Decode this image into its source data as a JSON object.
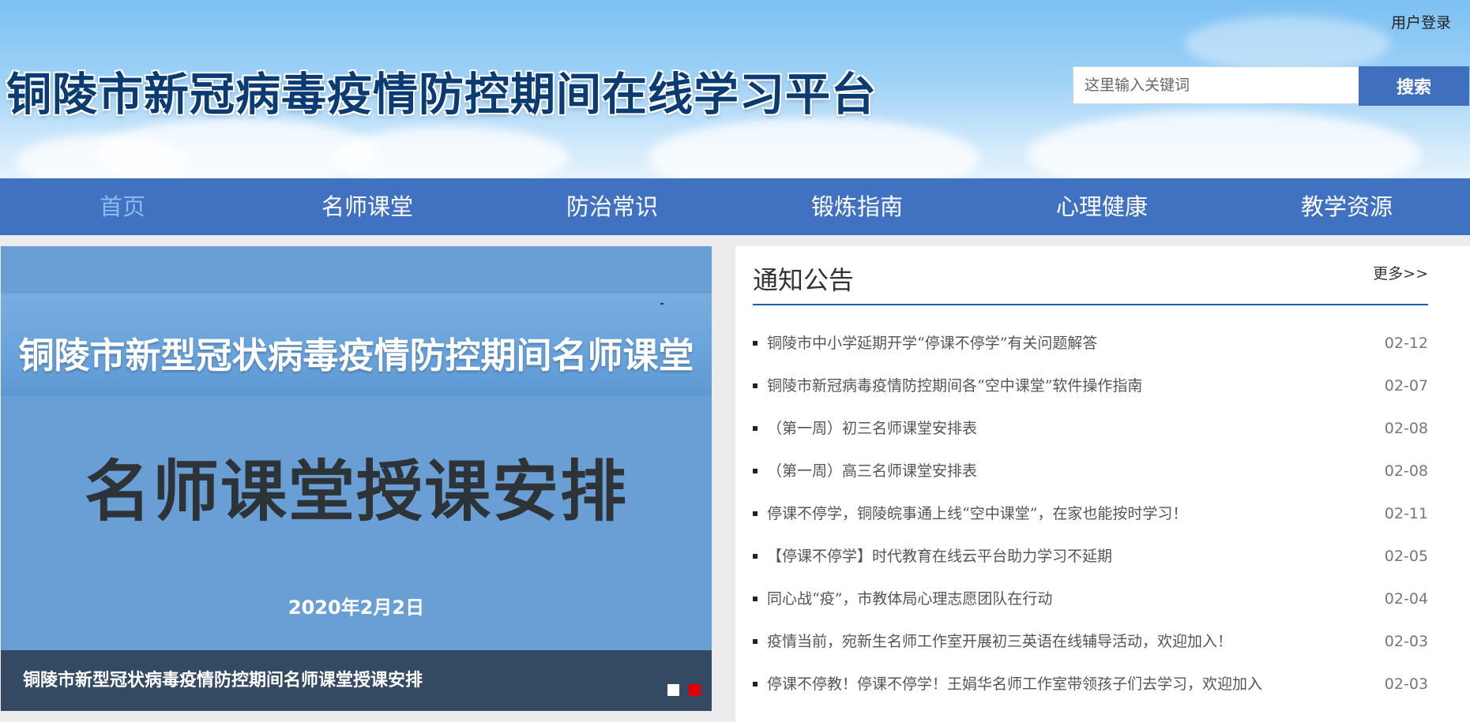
{
  "header": {
    "site_title": "铜陵市新冠病毒疫情防控期间在线学习平台",
    "login_label": "用户登录",
    "search": {
      "placeholder": "这里输入关键词",
      "value": "",
      "button_label": "搜索"
    }
  },
  "nav": {
    "items": [
      {
        "label": "首页",
        "active": true
      },
      {
        "label": "名师课堂",
        "active": false
      },
      {
        "label": "防治常识",
        "active": false
      },
      {
        "label": "锻炼指南",
        "active": false
      },
      {
        "label": "心理健康",
        "active": false
      },
      {
        "label": "教学资源",
        "active": false
      }
    ]
  },
  "banner": {
    "heading": "铜陵市新型冠状病毒疫情防控期间名师课堂",
    "main_text": "名师课堂授课安排",
    "date": "2020年2月2日",
    "caption": "铜陵市新型冠状病毒疫情防控期间名师课堂授课安排",
    "active_slide": 2
  },
  "notices": {
    "title": "通知公告",
    "more_label": "更多>>",
    "items": [
      {
        "text": "铜陵市中小学延期开学“停课不停学”有关问题解答",
        "date": "02-12"
      },
      {
        "text": "铜陵市新冠病毒疫情防控期间各“空中课堂”软件操作指南",
        "date": "02-07"
      },
      {
        "text": "（第一周）初三名师课堂安排表",
        "date": "02-08"
      },
      {
        "text": "（第一周）高三名师课堂安排表",
        "date": "02-08"
      },
      {
        "text": "停课不停学，铜陵皖事通上线“空中课堂”，在家也能按时学习！",
        "date": "02-11"
      },
      {
        "text": "【停课不停学】时代教育在线云平台助力学习不延期",
        "date": "02-05"
      },
      {
        "text": "同心战“疫”，市教体局心理志愿团队在行动",
        "date": "02-04"
      },
      {
        "text": "疫情当前，宛新生名师工作室开展初三英语在线辅导活动，欢迎加入！",
        "date": "02-03"
      },
      {
        "text": "停课不停教！停课不停学！王娟华名师工作室带领孩子们去学习，欢迎加入",
        "date": "02-03"
      }
    ]
  },
  "colors": {
    "nav_bg": "#4072c1",
    "nav_active": "#8bbbef",
    "search_button": "#3f6fbd",
    "title_text": "#0b3b73",
    "caption_bg": "#344a63",
    "notice_rule": "#1e5cb3"
  }
}
